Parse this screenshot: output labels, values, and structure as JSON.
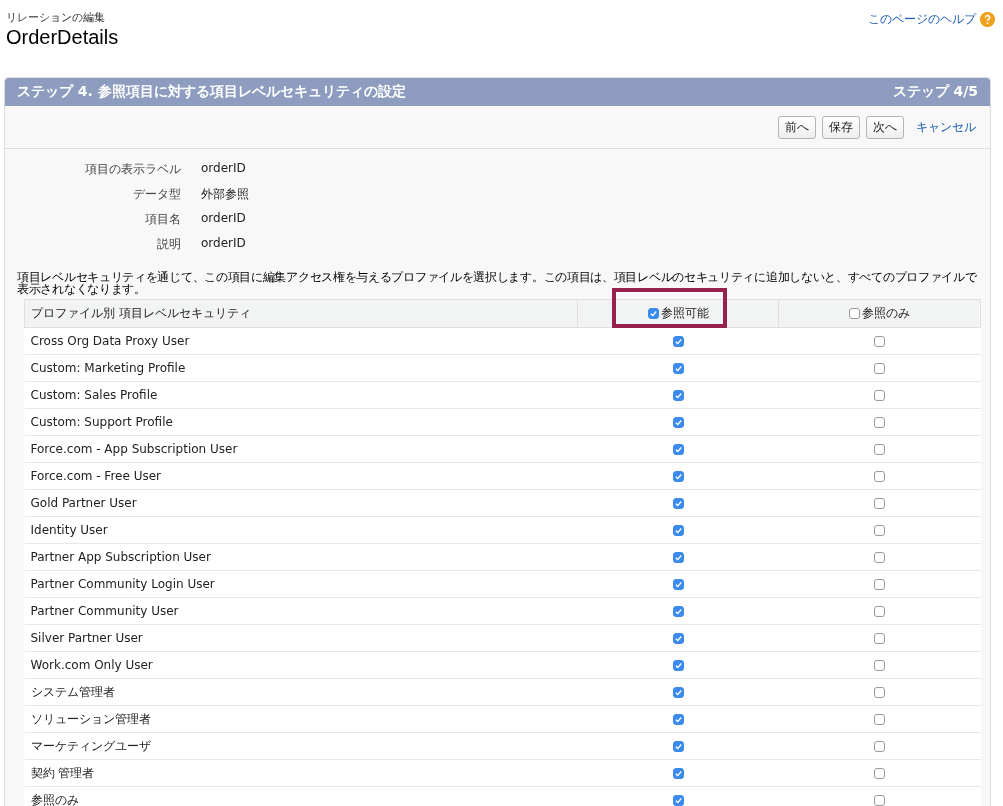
{
  "header": {
    "breadcrumb": "リレーションの編集",
    "title": "OrderDetails",
    "help_link": "このページのヘルプ"
  },
  "step_bar": {
    "title": "ステップ 4. 参照項目に対する項目レベルセキュリティの設定",
    "step": "ステップ 4/5"
  },
  "buttons": [
    {
      "label": "前へ",
      "kind": "button"
    },
    {
      "label": "保存",
      "kind": "button"
    },
    {
      "label": "次へ",
      "kind": "button"
    },
    {
      "label": "キャンセル",
      "kind": "link"
    }
  ],
  "details": [
    {
      "label": "項目の表示ラベル",
      "value": "orderID"
    },
    {
      "label": "データ型",
      "value": "外部参照"
    },
    {
      "label": "項目名",
      "value": "orderID"
    },
    {
      "label": "説明",
      "value": "orderID"
    }
  ],
  "instructions": "項目レベルセキュリティを通じて、この項目に編集アクセス権を与えるプロファイルを選択します。この項目は、項目レベルのセキュリティに追加しないと、すべてのプロファイルで表示されなくなります。",
  "table": {
    "columns": [
      {
        "label": "プロファイル別 項目レベルセキュリティ"
      },
      {
        "label": "参照可能",
        "checked": true,
        "highlighted": true
      },
      {
        "label": "参照のみ",
        "checked": false,
        "highlighted": false
      }
    ],
    "rows": [
      {
        "profile": "Cross Org Data Proxy User",
        "visible": true,
        "read_only": false
      },
      {
        "profile": "Custom: Marketing Profile",
        "visible": true,
        "read_only": false
      },
      {
        "profile": "Custom: Sales Profile",
        "visible": true,
        "read_only": false
      },
      {
        "profile": "Custom: Support Profile",
        "visible": true,
        "read_only": false
      },
      {
        "profile": "Force.com - App Subscription User",
        "visible": true,
        "read_only": false
      },
      {
        "profile": "Force.com - Free User",
        "visible": true,
        "read_only": false
      },
      {
        "profile": "Gold Partner User",
        "visible": true,
        "read_only": false
      },
      {
        "profile": "Identity User",
        "visible": true,
        "read_only": false
      },
      {
        "profile": "Partner App Subscription User",
        "visible": true,
        "read_only": false
      },
      {
        "profile": "Partner Community Login User",
        "visible": true,
        "read_only": false
      },
      {
        "profile": "Partner Community User",
        "visible": true,
        "read_only": false
      },
      {
        "profile": "Silver Partner User",
        "visible": true,
        "read_only": false
      },
      {
        "profile": "Work.com Only User",
        "visible": true,
        "read_only": false
      },
      {
        "profile": "システム管理者",
        "visible": true,
        "read_only": false
      },
      {
        "profile": "ソリューション管理者",
        "visible": true,
        "read_only": false
      },
      {
        "profile": "マーケティングユーザ",
        "visible": true,
        "read_only": false
      },
      {
        "profile": "契約 管理者",
        "visible": true,
        "read_only": false
      },
      {
        "profile": "参照のみ",
        "visible": true,
        "read_only": false
      }
    ]
  }
}
